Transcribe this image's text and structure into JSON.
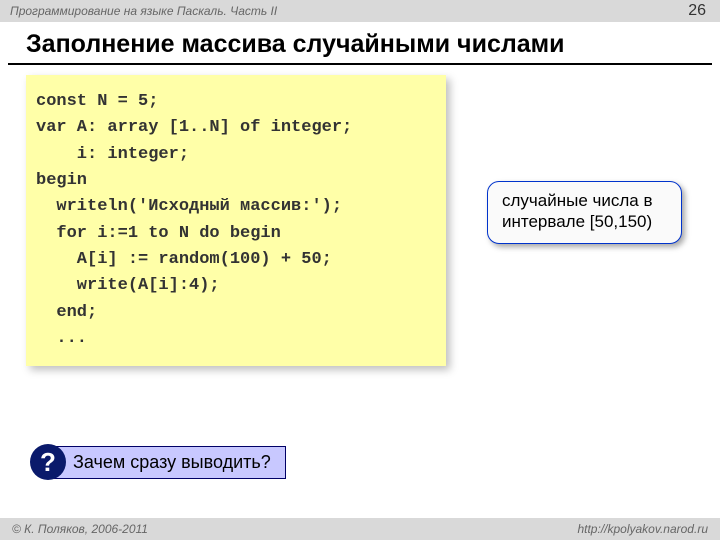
{
  "header": {
    "course": "Программирование на языке Паскаль. Часть II",
    "page": "26"
  },
  "title": "Заполнение массива случайными числами",
  "code": {
    "l1": "const N = 5;",
    "l2": "var A: array [1..N] of integer;",
    "l3": "    i: integer;",
    "l4": "begin",
    "l5": "  writeln('Исходный массив:');",
    "l6": "  for i:=1 to N do begin",
    "l7": "    A[i] := random(100) + 50;",
    "l8": "    write(A[i]:4);",
    "l9": "  end;",
    "l10": "  ..."
  },
  "callout": {
    "line1": "случайные числа в",
    "line2": "интервале [50,150)"
  },
  "question": {
    "mark": "?",
    "text": "Зачем сразу выводить?"
  },
  "footer": {
    "copyright": "© К. Поляков, 2006-2011",
    "url": "http://kpolyakov.narod.ru"
  }
}
